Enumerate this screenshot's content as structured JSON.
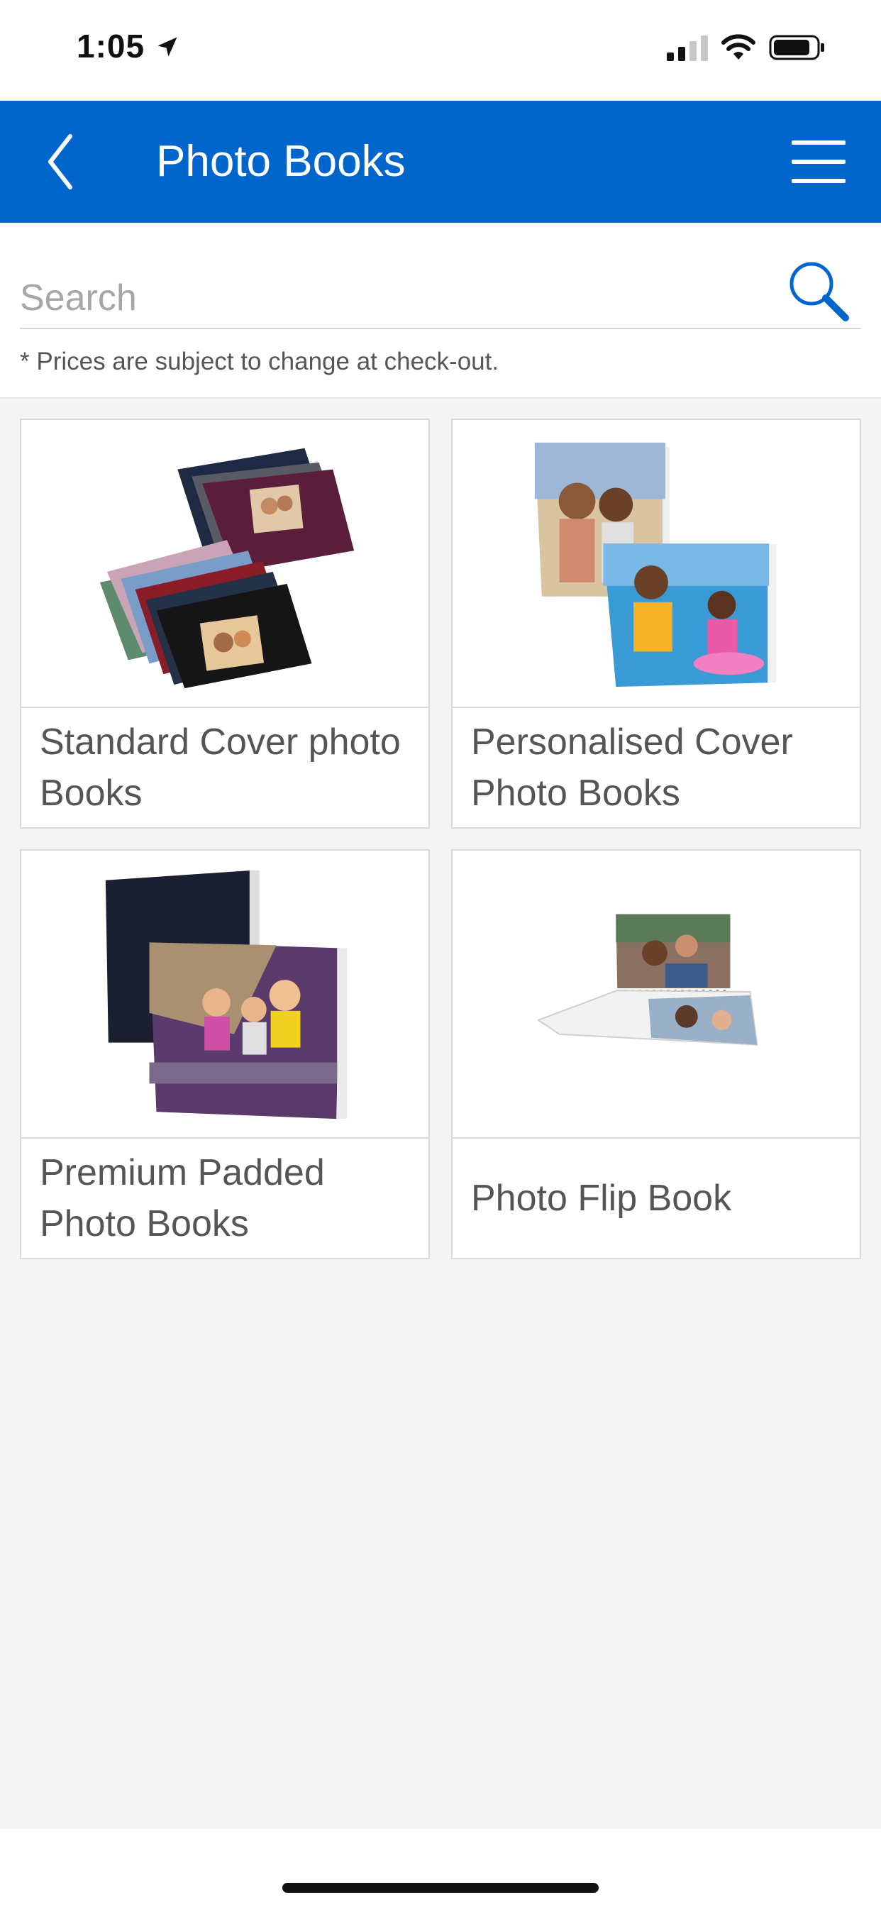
{
  "status_bar": {
    "time": "1:05"
  },
  "header": {
    "title": "Photo Books",
    "back_icon": "chevron-left-icon",
    "menu_icon": "hamburger-menu-icon",
    "background_color": "#0066cc"
  },
  "search": {
    "placeholder": "Search",
    "value": "",
    "icon": "search-icon",
    "icon_color": "#0066cc"
  },
  "disclaimer": "* Prices are subject to change at check-out.",
  "products": [
    {
      "label": "Standard Cover photo Books"
    },
    {
      "label": "Personalised Cover Photo Books"
    },
    {
      "label": "Premium Padded Photo Books"
    },
    {
      "label": "Photo Flip Book"
    }
  ]
}
